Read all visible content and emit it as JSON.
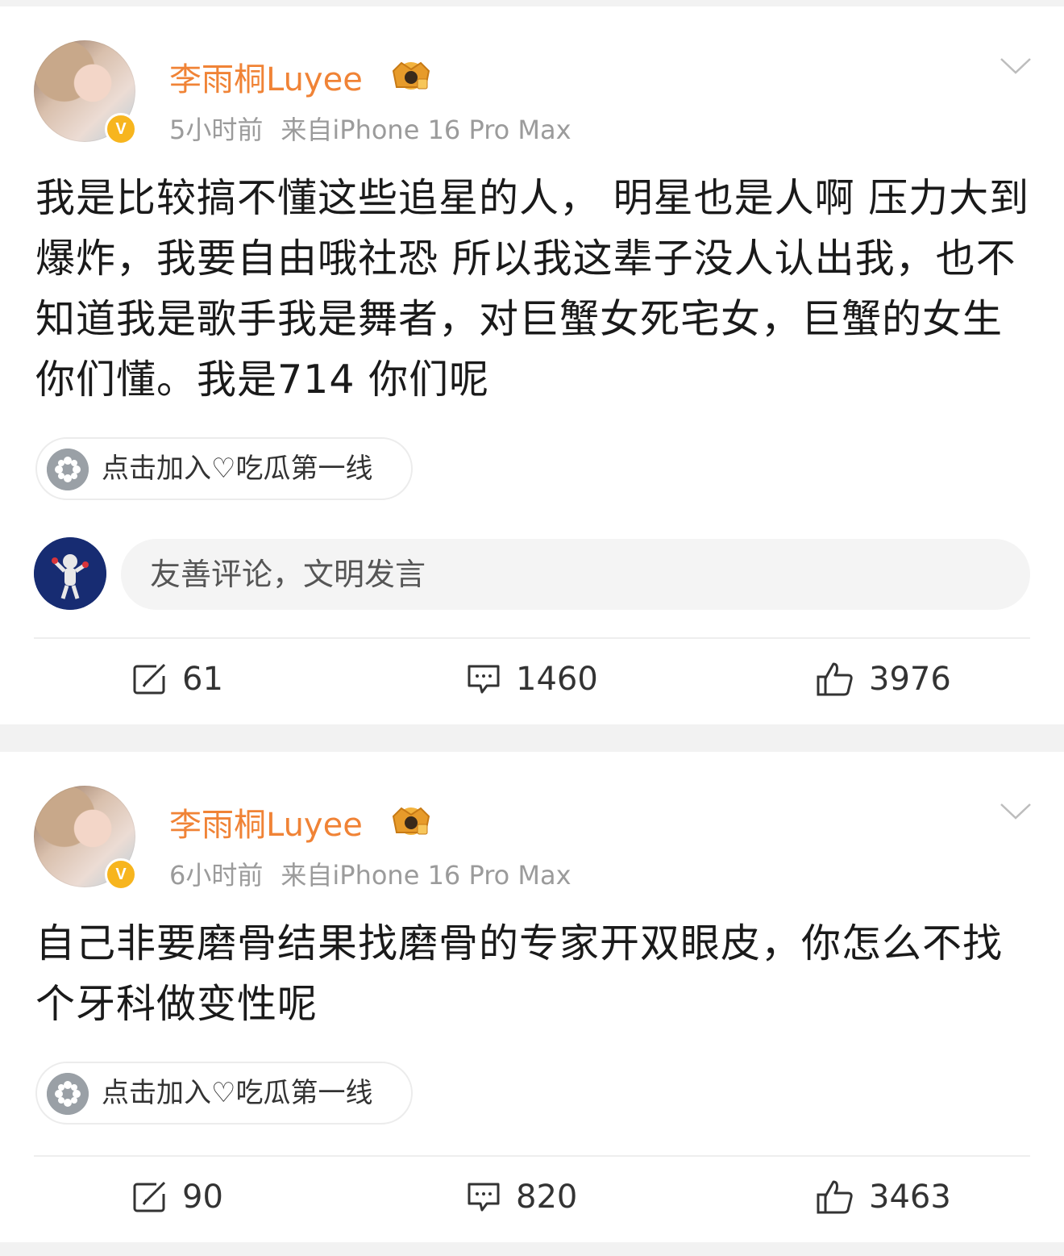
{
  "posts": [
    {
      "author": "李雨桐Luyee",
      "time": "5小时前",
      "source": "来自iPhone 16 Pro Max",
      "text": "我是比较搞不懂这些追星的人， 明星也是人啊 压力大到爆炸，我要自由哦社恐 所以我这辈子没人认出我，也不知道我是歌手我是舞者，对巨蟹女死宅女，巨蟹的女生你们懂。我是714 你们呢",
      "topic": "点击加入♡吃瓜第一线",
      "comment_placeholder": "友善评论，文明发言",
      "reposts": "61",
      "comments": "1460",
      "likes": "3976"
    },
    {
      "author": "李雨桐Luyee",
      "time": "6小时前",
      "source": "来自iPhone 16 Pro Max",
      "text": "自己非要磨骨结果找磨骨的专家开双眼皮，你怎么不找个牙科做变性呢",
      "topic": "点击加入♡吃瓜第一线",
      "reposts": "90",
      "comments": "820",
      "likes": "3463"
    }
  ],
  "icons": {
    "verified": "verified-v-badge",
    "crown": "crown-icon",
    "more": "chevron-down-icon",
    "topic": "flower-icon",
    "repost": "repost-icon",
    "comment": "comment-icon",
    "like": "thumbs-up-icon"
  },
  "colors": {
    "author_name": "#f08336",
    "verified_badge": "#f7b51e",
    "meta_text": "#9b9b9b",
    "background": "#f2f2f2"
  }
}
